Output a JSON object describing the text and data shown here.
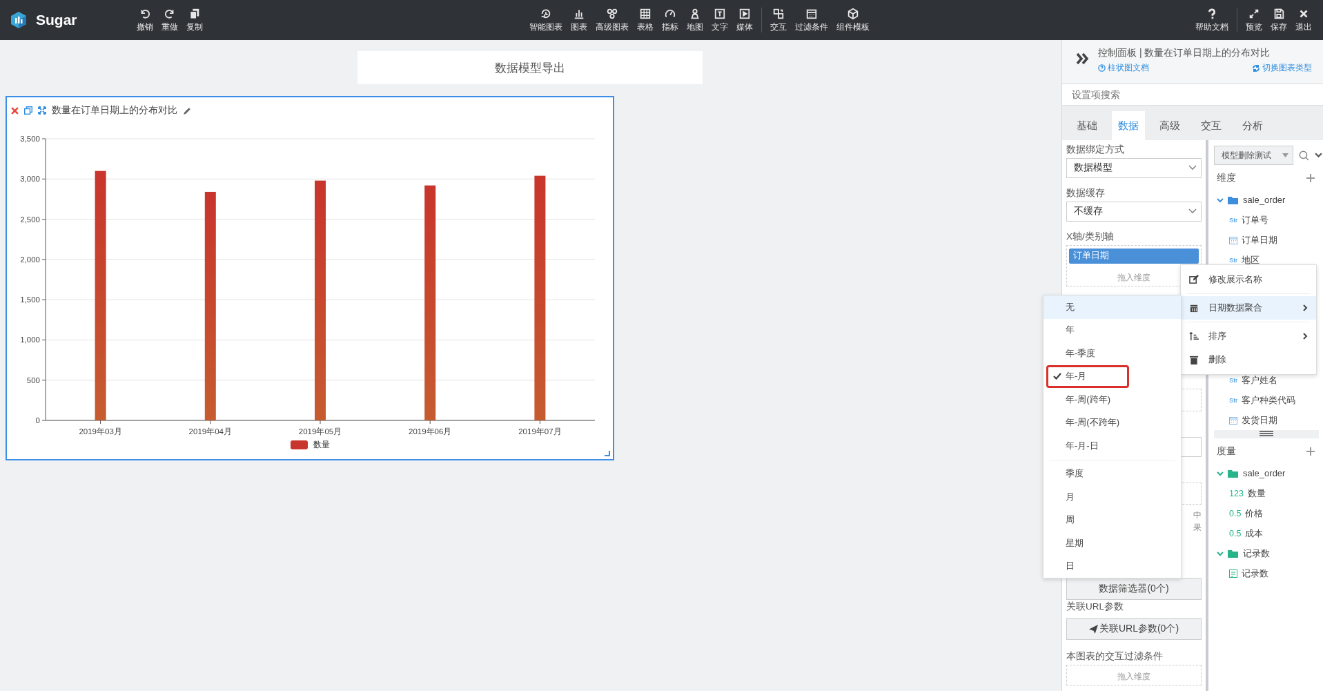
{
  "toolbar": {
    "logo": "Sugar",
    "left": [
      {
        "label": "撤销"
      },
      {
        "label": "重做"
      },
      {
        "label": "复制"
      }
    ],
    "center": [
      {
        "label": "智能图表"
      },
      {
        "label": "图表"
      },
      {
        "label": "高级图表"
      },
      {
        "label": "表格"
      },
      {
        "label": "指标"
      },
      {
        "label": "地图"
      },
      {
        "label": "文字"
      },
      {
        "label": "媒体"
      }
    ],
    "center2": [
      {
        "label": "交互"
      },
      {
        "label": "过滤条件"
      },
      {
        "label": "组件模板"
      }
    ],
    "help": {
      "label": "帮助文档"
    },
    "right": [
      {
        "label": "预览"
      },
      {
        "label": "保存"
      },
      {
        "label": "退出"
      }
    ]
  },
  "canvas": {
    "title_box": "数据模型导出",
    "chart_card": {
      "title": "数量在订单日期上的分布对比",
      "selected": true,
      "chart_data": {
        "type": "bar",
        "grid": true,
        "categories": [
          "2019年03月",
          "2019年04月",
          "2019年05月",
          "2019年06月",
          "2019年07月"
        ],
        "series": [
          {
            "name": "数量",
            "color": "#c8352c",
            "values": [
              3100,
              2840,
              2980,
              2920,
              3040
            ]
          }
        ],
        "ylim": [
          0,
          3500
        ],
        "yticks": [
          {
            "value": 0,
            "label": "0"
          },
          {
            "value": 500,
            "label": "500"
          },
          {
            "value": 1000,
            "label": "1,000"
          },
          {
            "value": 1500,
            "label": "1,500"
          },
          {
            "value": 2000,
            "label": "2,000"
          },
          {
            "value": 2500,
            "label": "2,500"
          },
          {
            "value": 3000,
            "label": "3,000"
          },
          {
            "value": 3500,
            "label": "3,500"
          }
        ]
      }
    }
  },
  "panel": {
    "title": "控制面板 | 数量在订单日期上的分布对比",
    "doc_link": "柱状图文档",
    "switch_link": "切换图表类型",
    "search": {
      "placeholder": "设置项搜索"
    },
    "tabs": [
      {
        "label": "基础",
        "selected": false
      },
      {
        "label": "数据",
        "selected": true
      },
      {
        "label": "高级",
        "selected": false
      },
      {
        "label": "交互",
        "selected": false
      },
      {
        "label": "分析",
        "selected": false
      }
    ],
    "settings": {
      "binding_label": "数据绑定方式",
      "binding_value": "数据模型",
      "cache_label": "数据缓存",
      "cache_value": "不缓存",
      "x_axis_label": "X轴/类别轴",
      "x_axis_chip": "订单日期",
      "x_axis_drop": "拖入维度",
      "note_fragments": [
        "中",
        "果"
      ],
      "filter_button": "数据筛选器(0个)",
      "url_label": "关联URL参数",
      "url_button": "关联URL参数(0个)",
      "interaction_label": "本图表的交互过滤条件",
      "interaction_drop": "拖入维度"
    },
    "model": {
      "dropdown": "模型删除测试",
      "dimensions": {
        "title": "维度",
        "tree": [
          {
            "name": "sale_order",
            "expanded": true,
            "children": [
              {
                "kind": "str",
                "type_label": "Str",
                "name": "订单号"
              },
              {
                "kind": "date",
                "name": "订单日期"
              },
              {
                "kind": "str",
                "type_label": "Str",
                "name": "地区",
                "gap_after": true
              },
              {
                "kind": "str",
                "type_label": "Str",
                "name": "客户姓名"
              },
              {
                "kind": "str",
                "type_label": "Str",
                "name": "客户种类代码"
              },
              {
                "kind": "date",
                "name": "发货日期"
              }
            ]
          }
        ]
      },
      "measures": {
        "title": "度量",
        "tree": [
          {
            "name": "sale_order",
            "expanded": true,
            "children": [
              {
                "kind": "num",
                "type_label": "123",
                "name": "数量"
              },
              {
                "kind": "num",
                "type_label": "0.5",
                "name": "价格"
              },
              {
                "kind": "num",
                "type_label": "0.5",
                "name": "成本"
              }
            ]
          },
          {
            "name": "记录数",
            "expanded": true,
            "children": [
              {
                "kind": "count",
                "name": "记录数"
              }
            ]
          }
        ]
      }
    }
  },
  "context_menu": [
    {
      "label": "修改展示名称",
      "highlighted": false,
      "has_submenu": false
    },
    {
      "label": "日期数据聚合",
      "highlighted": true,
      "has_submenu": true
    },
    {
      "label": "排序",
      "highlighted": false,
      "has_submenu": true
    },
    {
      "label": "删除",
      "highlighted": false,
      "has_submenu": false
    }
  ],
  "submenu": [
    {
      "label": "无",
      "highlighted": true,
      "checked": false,
      "outlined": false
    },
    {
      "label": "年",
      "highlighted": false,
      "checked": false,
      "outlined": false
    },
    {
      "label": "年-季度",
      "highlighted": false,
      "checked": false,
      "outlined": false
    },
    {
      "label": "年-月",
      "highlighted": false,
      "checked": true,
      "outlined": true
    },
    {
      "label": "年-周(跨年)",
      "highlighted": false,
      "checked": false,
      "outlined": false
    },
    {
      "label": "年-周(不跨年)",
      "highlighted": false,
      "checked": false,
      "outlined": false
    },
    {
      "label": "年-月-日",
      "highlighted": false,
      "checked": false,
      "outlined": false,
      "divider_after": true
    },
    {
      "label": "季度",
      "highlighted": false,
      "checked": false,
      "outlined": false
    },
    {
      "label": "月",
      "highlighted": false,
      "checked": false,
      "outlined": false
    },
    {
      "label": "周",
      "highlighted": false,
      "checked": false,
      "outlined": false
    },
    {
      "label": "星期",
      "highlighted": false,
      "checked": false,
      "outlined": false
    },
    {
      "label": "日",
      "highlighted": false,
      "checked": false,
      "outlined": false
    }
  ]
}
